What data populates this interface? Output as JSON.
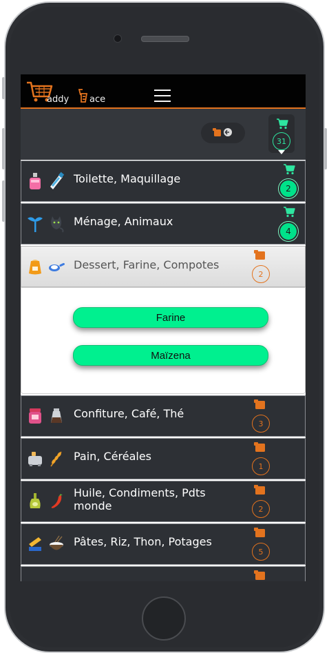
{
  "app": {
    "logo_letters": [
      "addy",
      "ace"
    ],
    "colors": {
      "accent_orange": "#e3731e",
      "accent_green": "#00e28a",
      "row_bg": "#2d3035"
    }
  },
  "toolbar": {
    "cart_count": "31",
    "back_icon": "list-back-icon"
  },
  "categories": [
    {
      "label": "Toilette, Maquillage",
      "count": "2",
      "state": "cart",
      "icons": [
        "perfume-icon",
        "toothpaste-icon"
      ]
    },
    {
      "label": "Ménage, Animaux",
      "count": "4",
      "state": "cart",
      "icons": [
        "duster-icon",
        "cat-icon"
      ]
    },
    {
      "label": "Dessert, Farine, Compotes",
      "count": "2",
      "state": "list",
      "icons": [
        "flour-sack-icon",
        "pan-icon"
      ],
      "expanded": true,
      "items": [
        "Farine",
        "Maïzena"
      ]
    },
    {
      "label": "Confiture, Café, Thé",
      "count": "3",
      "state": "list",
      "icons": [
        "jam-jar-icon",
        "coffee-pot-icon"
      ]
    },
    {
      "label": "Pain, Céréales",
      "count": "1",
      "state": "list",
      "icons": [
        "toaster-icon",
        "wheat-icon"
      ]
    },
    {
      "label": "Huile, Condiments, Pdts monde",
      "count": "2",
      "state": "list",
      "icons": [
        "oil-bottle-icon",
        "chili-icon"
      ]
    },
    {
      "label": "Pâtes, Riz, Thon, Potages",
      "count": "5",
      "state": "list",
      "icons": [
        "pasta-icon",
        "rice-bowl-icon"
      ]
    }
  ]
}
